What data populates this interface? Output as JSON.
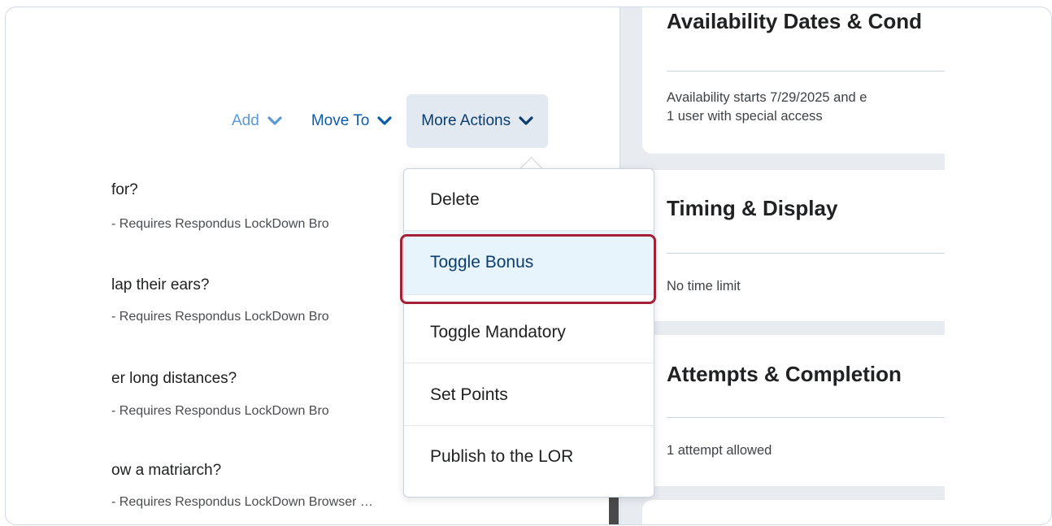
{
  "toolbar": {
    "add_label": "Add",
    "move_label": "Move To",
    "more_label": "More Actions"
  },
  "questions": [
    {
      "title": "for?",
      "subtitle": "- Requires Respondus LockDown Bro"
    },
    {
      "title": "lap their ears?",
      "subtitle": "- Requires Respondus LockDown Bro"
    },
    {
      "title": "er long distances?",
      "subtitle": "- Requires Respondus LockDown Bro"
    },
    {
      "title": "ow a matriarch?",
      "subtitle": "- Requires Respondus LockDown Browser …"
    }
  ],
  "menu": {
    "items": [
      "Delete",
      "Toggle Bonus",
      "Toggle Mandatory",
      "Set Points",
      "Publish to the LOR"
    ],
    "highlighted": "Toggle Bonus"
  },
  "panels": {
    "availability": {
      "title": "Availability Dates & Cond",
      "line1": "Availability starts 7/29/2025 and e",
      "line2": "1 user with special access"
    },
    "timing": {
      "title": "Timing & Display",
      "desc": "No time limit"
    },
    "attempts": {
      "title": "Attempts & Completion",
      "desc": "1 attempt allowed"
    }
  },
  "colors": {
    "accent": "#0b5cad",
    "highlight_border": "#a32036",
    "highlight_bg": "#e8f4fb"
  },
  "icons": [
    "chevron-down-icon"
  ]
}
